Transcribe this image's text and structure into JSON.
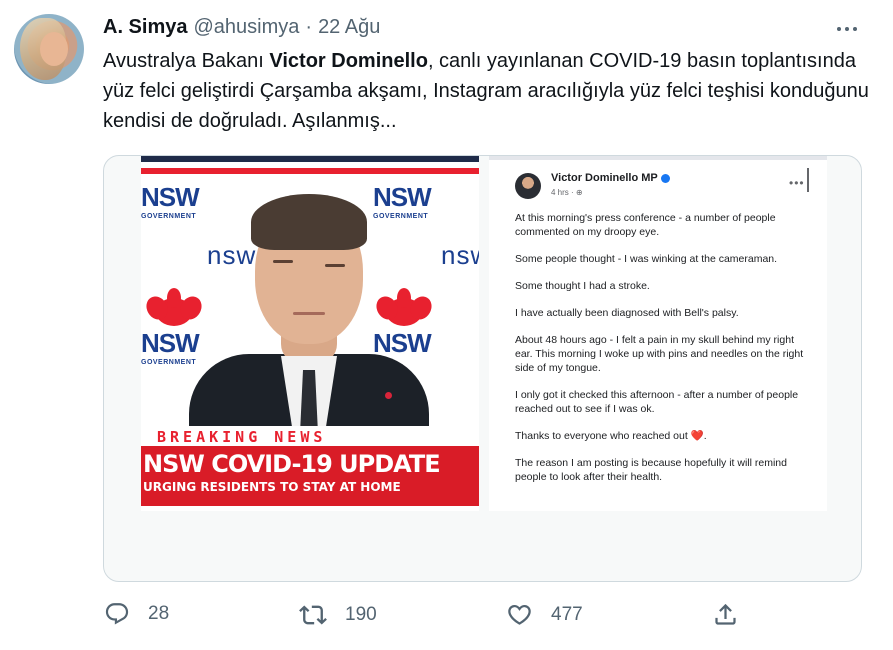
{
  "author": {
    "name": "A. Simya",
    "handle": "@ahusimya",
    "separator": "·",
    "date": "22 Ağu"
  },
  "tweet": {
    "text_before": "Avustralya Bakanı ",
    "text_bold": "Victor Dominello",
    "text_after": ", canlı yayınlanan COVID-19 basın toplantısında yüz felci geliştirdi Çarşamba akşamı, Instagram aracılığıyla yüz felci teşhisi konduğunu kendisi de doğruladı. Aşılanmış..."
  },
  "media": {
    "tv": {
      "logo_text": "NSW",
      "logo_sub": "GOVERNMENT",
      "brand_lower": "nsw",
      "breaking": "BREAKING NEWS",
      "headline": "NSW COVID-19 UPDATE",
      "subhead": "URGING RESIDENTS TO STAY AT HOME"
    },
    "post": {
      "author": "Victor Dominello MP",
      "meta": "4 hrs · ⊕",
      "more": "•••",
      "paragraphs": [
        "At this morning's press conference - a number of people commented on my droopy eye.",
        "Some people thought - I was winking at the cameraman.",
        "Some thought I had a stroke.",
        "I have actually been diagnosed with Bell's palsy.",
        "About 48 hours ago - I felt a pain in my skull behind my right ear. This morning I woke up with pins and needles on the right side of my tongue.",
        "I only got it checked this afternoon - after a number of people reached out to see if I was ok.",
        "Thanks to everyone who reached out",
        "The reason I am posting is because hopefully it will remind people to look after their health."
      ],
      "heart": "❤️"
    }
  },
  "actions": {
    "reply_count": "28",
    "retweet_count": "190",
    "like_count": "477"
  },
  "colors": {
    "text": "#0f1419",
    "muted": "#536471",
    "border": "#cfd9de",
    "nsw_red": "#e8212f",
    "nsw_blue": "#1b3f8f"
  },
  "icons": [
    "more-icon",
    "reply-icon",
    "retweet-icon",
    "like-icon",
    "share-icon",
    "verified-icon",
    "heart-icon"
  ]
}
